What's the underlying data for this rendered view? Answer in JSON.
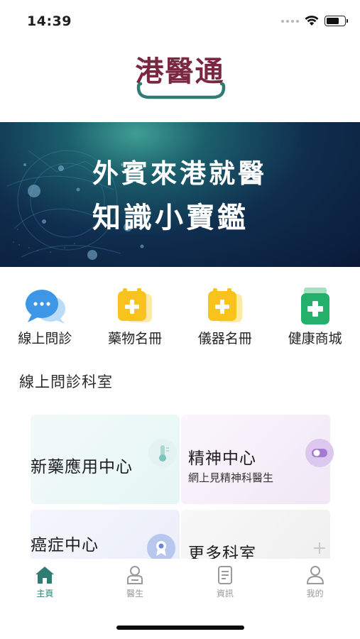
{
  "status_bar": {
    "time": "14:39",
    "battery_level": 0.7
  },
  "logo": {
    "text": "港醫通",
    "color": "#7a2841",
    "accent": "#2f7d72"
  },
  "banner": {
    "line1": "外賓來港就醫",
    "line2": "知識小寶鑑"
  },
  "quick_menu": [
    {
      "label": "線上問診",
      "icon": "chat-bubbles-icon"
    },
    {
      "label": "藥物名冊",
      "icon": "medicine-box-icon"
    },
    {
      "label": "儀器名冊",
      "icon": "equipment-box-icon"
    },
    {
      "label": "健康商城",
      "icon": "medicine-bottle-icon"
    }
  ],
  "section": {
    "title": "線上問診科室"
  },
  "departments": [
    {
      "title": "新藥應用中心",
      "subtitle": "",
      "icon": "thermometer-icon"
    },
    {
      "title": "精神中心",
      "subtitle": "網上見精神科醫生",
      "icon": "toggle-icon"
    },
    {
      "title": "癌症中心",
      "subtitle": "",
      "icon": "award-icon"
    },
    {
      "title": "更多科室",
      "subtitle": "",
      "icon": "plus-icon"
    }
  ],
  "tabs": [
    {
      "label": "主頁",
      "icon": "home-icon",
      "active": true
    },
    {
      "label": "醫生",
      "icon": "doctor-icon",
      "active": false
    },
    {
      "label": "資訊",
      "icon": "document-icon",
      "active": false
    },
    {
      "label": "我的",
      "icon": "profile-icon",
      "active": false
    }
  ],
  "colors": {
    "brand": "#7a2841",
    "accent": "#2f7d72",
    "inactive_tab": "#9a9a9a"
  }
}
